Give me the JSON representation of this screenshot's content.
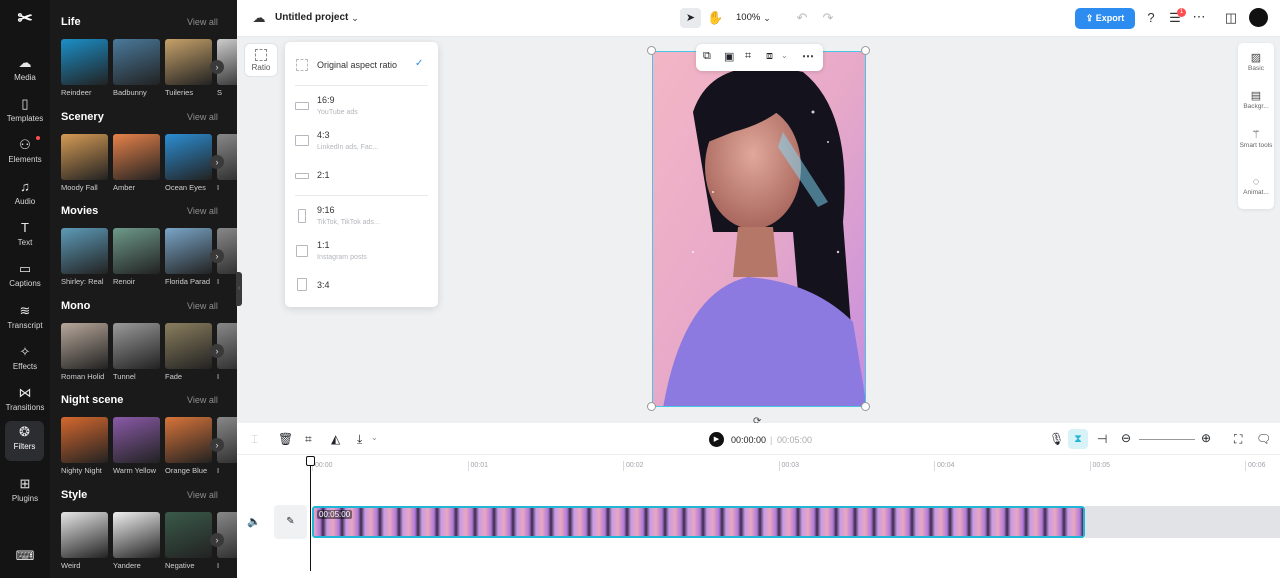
{
  "rail": {
    "items": [
      {
        "label": "Media",
        "icon": "cloud-icon"
      },
      {
        "label": "Templates",
        "icon": "templates-icon"
      },
      {
        "label": "Elements",
        "icon": "elements-icon"
      },
      {
        "label": "Audio",
        "icon": "music-icon"
      },
      {
        "label": "Text",
        "icon": "text-icon"
      },
      {
        "label": "Captions",
        "icon": "captions-icon"
      },
      {
        "label": "Transcript",
        "icon": "transcript-icon"
      },
      {
        "label": "Effects",
        "icon": "sparkle-icon"
      },
      {
        "label": "Transitions",
        "icon": "transitions-icon"
      },
      {
        "label": "Filters",
        "icon": "filters-icon"
      },
      {
        "label": "Plugins",
        "icon": "plugins-icon"
      }
    ]
  },
  "filters": {
    "view_all": "View all",
    "sections": [
      {
        "title": "Life",
        "items": [
          "Reindeer",
          "Badbunny",
          "Tuileries",
          "S"
        ]
      },
      {
        "title": "Scenery",
        "items": [
          "Moody Fall",
          "Amber",
          "Ocean Eyes",
          "I"
        ]
      },
      {
        "title": "Movies",
        "items": [
          "Shirley: Real",
          "Renoir",
          "Florida Parad",
          "I"
        ]
      },
      {
        "title": "Mono",
        "items": [
          "Roman Holid",
          "Tunnel",
          "Fade",
          "I"
        ]
      },
      {
        "title": "Night scene",
        "items": [
          "Nighty Night",
          "Warm Yellow",
          "Orange Blue",
          "I"
        ]
      },
      {
        "title": "Style",
        "items": [
          "Weird",
          "Yandere",
          "Negative",
          "I"
        ]
      }
    ]
  },
  "topbar": {
    "project_title": "Untitled project",
    "zoom": "100%",
    "export_label": "Export",
    "notification_count": "1"
  },
  "ratio": {
    "button_label": "Ratio",
    "options": [
      {
        "label": "Original aspect ratio",
        "sub": "",
        "selected": true
      },
      {
        "label": "16:9",
        "sub": "YouTube ads"
      },
      {
        "label": "4:3",
        "sub": "LinkedIn ads, Fac..."
      },
      {
        "label": "2:1",
        "sub": ""
      },
      {
        "label": "9:16",
        "sub": "TikTok, TikTok ads..."
      },
      {
        "label": "1:1",
        "sub": "Instagram posts"
      },
      {
        "label": "3:4",
        "sub": ""
      }
    ]
  },
  "right_panel": {
    "items": [
      "Basic",
      "Backgr...",
      "Smart tools",
      "Animat..."
    ]
  },
  "timeline": {
    "current_time": "00:00:00",
    "total_time": "00:05:00",
    "clip_duration": "00:05:00",
    "ticks": [
      "00:00",
      "00:01",
      "00:02",
      "00:03",
      "00:04",
      "00:05",
      "00:06"
    ]
  }
}
